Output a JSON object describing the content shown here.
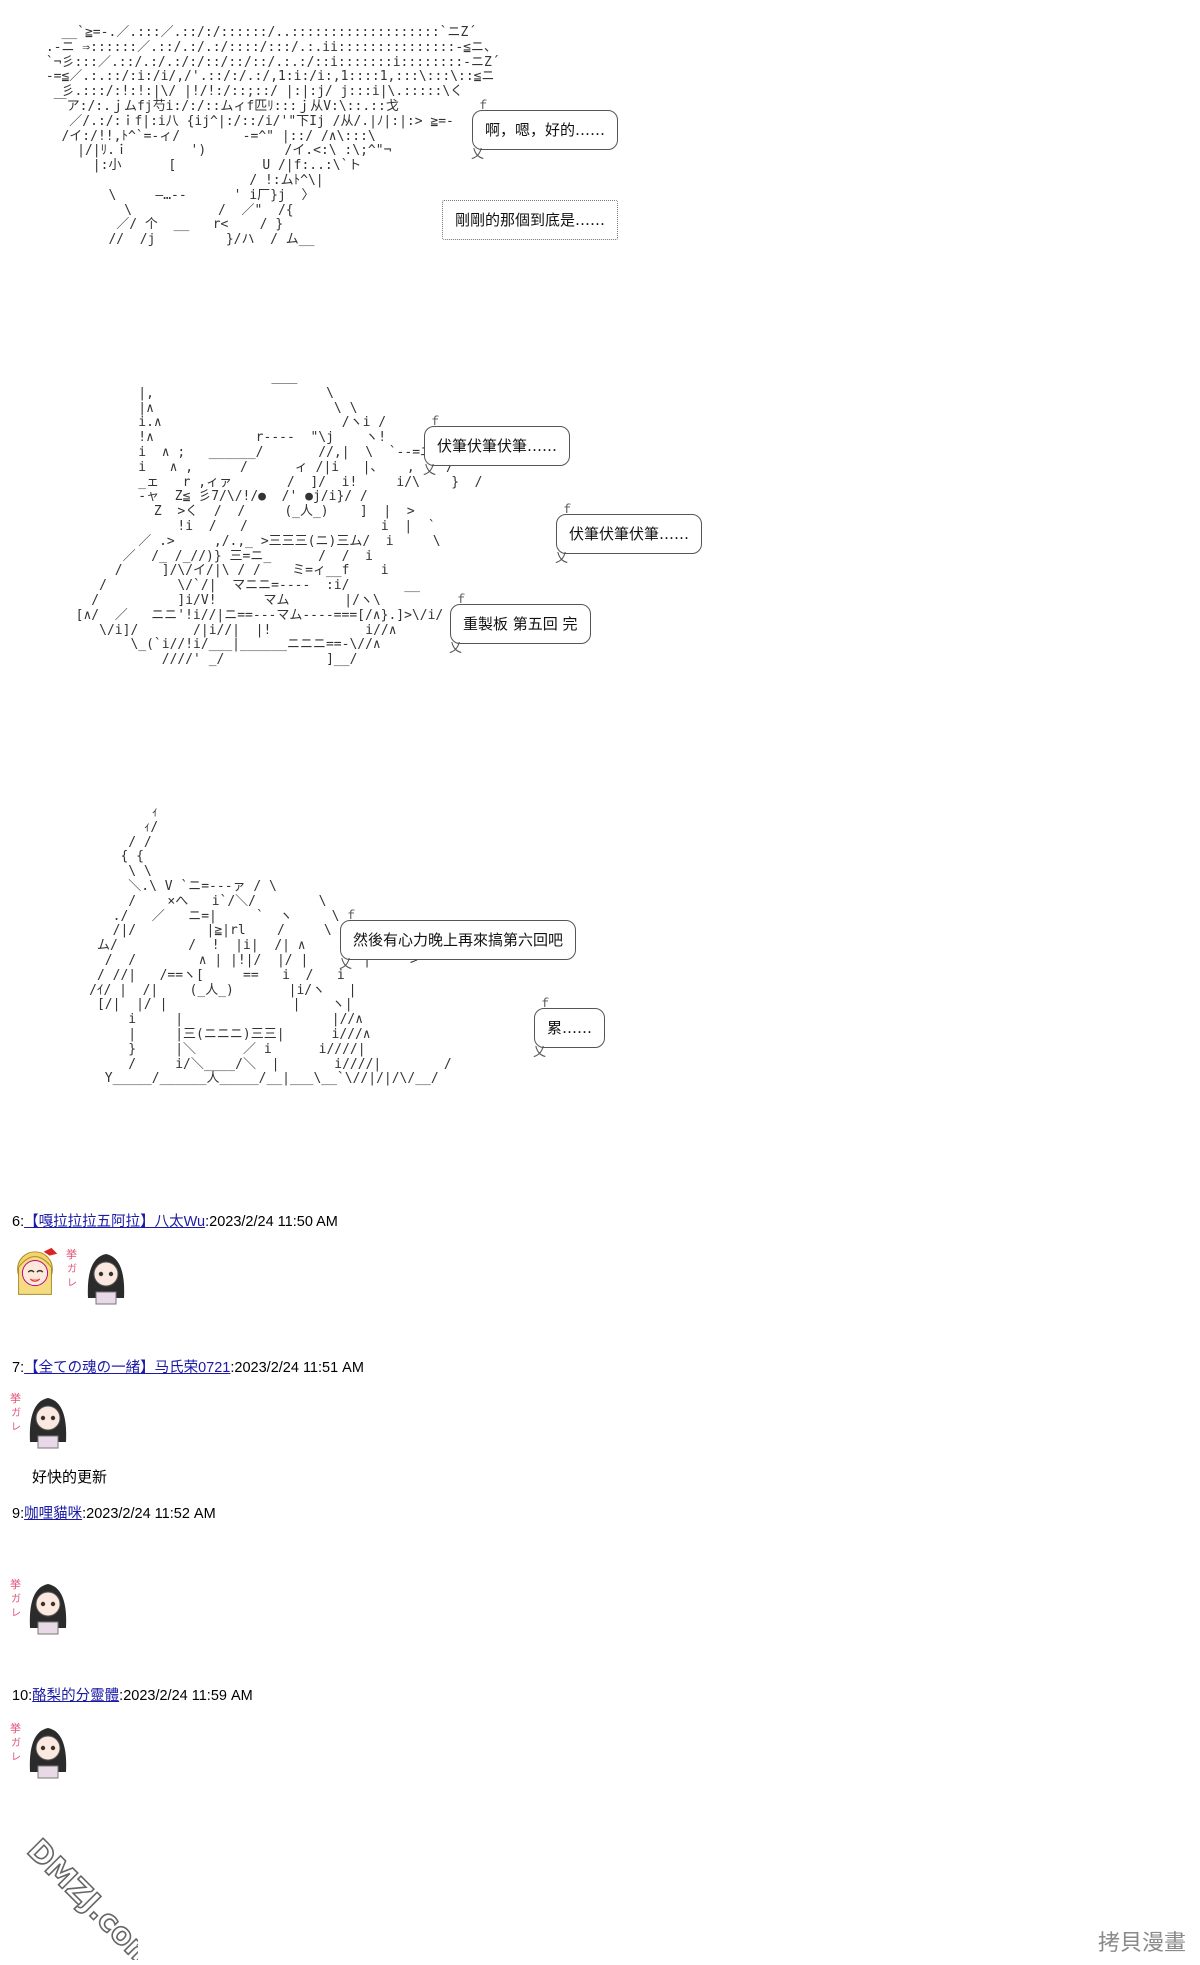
{
  "panels": [
    {
      "art": "   __`≧=-.／.:::／.::/:/::::::/..:::::::::::::::::::`ニZ´\n .-ニ ⇒::::::／.::/.:/.:/::::/:::/.:.ii:::::::::::::::-≦ニ、\n `¬彡:::／.::/.:/.:/:/::/::/::/.:.:/::i:::::::i::::::::-ニZ´\n -=≦／.:.::/:i:/i/,/'.::/:/.:/,1:i:/i:,1::::1,:::\\:::\\::≦ニ\n   彡.:::/:!:!:|\\/ |!/!:/::;::/ |:|:j/ j:::i|\\.:::::\\く\n  ￣ア:/:.ｊムfj芍i:/:/::ムィf匹ﾘ:::ｊ从V:\\::.::戈\n    ／/.:/:ｉf|:i八 {ij^|:/::/i/'\"下Ij /从/.|ﾉ|:|:> ≧=-\n   /イ:/!!,ﾄ^`=-ィ/        -=^\" |::/ /∧\\:::\\\n     |/|ﾘ.ｉ        ')          /イ.<:\\ :\\;^\"¬\n       |:小      [           U /|f:..:\\`ト\n                           / !:ムﾄ^\\|\n         \\     ―…--      ' i厂}j  〉\n           \\           /  ／\"  /{\n          ／/ 个  __   r<    / }\n         //  /j         }/ハ  / ム__",
      "bubbles": [
        "啊，嗯，好的……",
        "剛剛的那個到底是……"
      ]
    },
    {
      "art": "                           ＿＿\n          |,                      \\\n          |∧                       \\ \\\n          i.∧                       /ヽi /\n          !∧             r----  \"\\j    ヽ!\n          i  ∧ ;   ______/       //,|  \\  `--=ニ_\n          i   ∧ ,      /      ィ /|i   |、   ,    /\n          _ェ   r ,ィァ       /  ]/  i!     i/\\    }  /\n          -ャ  Z≦ 彡7/\\/!/●  /' ●j/i}/ /\n            Z  >く  /  /     (_人_)    ]  |  >\n               !i  /   /                 i  |  `\n          ／ .>     ,/.,_ >三三三(ニ)三ム/  i     \\\n        ／  /_ /_//)} 三=ニ_      /  /  i\n       /     ]/\\/イ/|\\ / /    ミ=ィ__f    i\n     /         \\/`/|  マニニ=----  :i/       __\n    /          ]i/V!      マム       |/ヽ\\\n  [∧/  ／   ニニ'!i//|ニ==---マム----===[/∧}.]>\\/i/\n     \\/i]/       /|i//|  |!            i//∧\n         \\_(`i//!i/___|______ニニニ==-\\//∧\n             ////' _/             ]__/",
      "bubbles": [
        "伏筆伏筆伏筆……",
        "伏筆伏筆伏筆……",
        "重製板 第五回 完"
      ]
    },
    {
      "art": "             ｨ\n            ｨ/\n          / /\n         { {\n          \\ \\\n          ＼.\\ V `ニ=---ァ / \\\n          /    ×へ   i`/＼/        \\\n        ./   ／   ニ=|     `  ヽ     \\\n        /|/         |≧|rl    /     \\  }\n      ム/         /  !  |i|  /| ∧      ヽ ┌ ‐ 、\n       /  /        ∧ | |!|/  |/ |       |     >\n      / //|   /==ヽ[     ==   i  /   i\n     /ｲ/ |  /|    (_人_)       |i/ヽ   |\n      [/|  |/ |                |    ヽ|\n          i     |                   |//∧\n          |     |三(ニニニ)三三|      i///∧\n          }     |＼      ／ i      i////|\n          /     i/＼____/＼  |       i////|        /\n       Y_____/______人_____/__|___\\__`\\//|/|/\\/__/",
      "bubbles": [
        "然後有心力晚上再來搞第六回吧",
        "累……"
      ]
    }
  ],
  "posts": [
    {
      "number": "6",
      "author": "【嘎拉拉拉五阿拉】八太Wu",
      "timestamp": "2023/2/24 11:50 AM",
      "text": ""
    },
    {
      "number": "7",
      "author": "【全ての魂の一緒】马氏荣0721",
      "timestamp": "2023/2/24 11:51 AM",
      "text": "好快的更新"
    },
    {
      "number": "9",
      "author": "咖哩貓咪",
      "timestamp": "2023/2/24 11:52 AM",
      "text": ""
    },
    {
      "number": "10",
      "author": "酪梨的分靈體",
      "timestamp": "2023/2/24 11:59 AM",
      "text": ""
    }
  ],
  "watermark_text": "DMZJ.com",
  "copyright": "拷貝漫畫"
}
